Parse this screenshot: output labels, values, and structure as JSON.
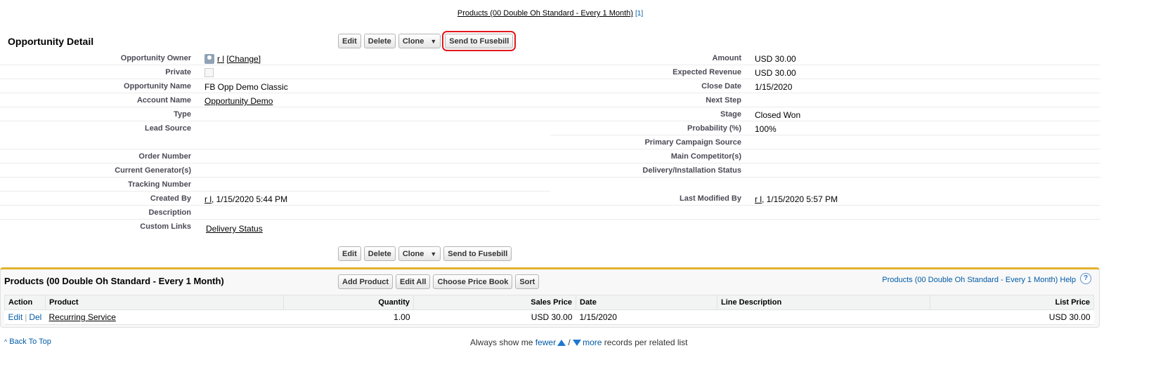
{
  "top_link": {
    "label": "Products (00 Double Oh Standard - Every 1 Month)",
    "count": "[1]"
  },
  "detail": {
    "title": "Opportunity Detail",
    "buttons": {
      "edit": "Edit",
      "delete": "Delete",
      "clone": "Clone",
      "send": "Send to Fusebill"
    },
    "left": {
      "owner_label": "Opportunity Owner",
      "owner_value": "r l",
      "owner_change": "[Change]",
      "private_label": "Private",
      "name_label": "Opportunity Name",
      "name_value": "FB Opp Demo Classic",
      "account_label": "Account Name",
      "account_value": "Opportunity Demo",
      "type_label": "Type",
      "lead_label": "Lead Source",
      "order_label": "Order Number",
      "generator_label": "Current Generator(s)",
      "tracking_label": "Tracking Number",
      "created_label": "Created By",
      "created_user": "r l",
      "created_date": ", 1/15/2020 5:44 PM",
      "description_label": "Description",
      "custom_label": "Custom Links",
      "custom_value": "Delivery Status"
    },
    "right": {
      "amount_label": "Amount",
      "amount_value": "USD 30.00",
      "expected_label": "Expected Revenue",
      "expected_value": "USD 30.00",
      "close_label": "Close Date",
      "close_value": "1/15/2020",
      "next_label": "Next Step",
      "stage_label": "Stage",
      "stage_value": "Closed Won",
      "prob_label": "Probability (%)",
      "prob_value": "100%",
      "campaign_label": "Primary Campaign Source",
      "competitor_label": "Main Competitor(s)",
      "delivery_label": "Delivery/Installation Status",
      "modified_label": "Last Modified By",
      "modified_user": "r l",
      "modified_date": ", 1/15/2020 5:57 PM"
    }
  },
  "products": {
    "title": "Products (00 Double Oh Standard - Every 1 Month)",
    "buttons": {
      "add": "Add Product",
      "edit_all": "Edit All",
      "price_book": "Choose Price Book",
      "sort": "Sort"
    },
    "help": "Products (00 Double Oh Standard - Every 1 Month) Help",
    "help_icon": "?",
    "columns": {
      "action": "Action",
      "product": "Product",
      "quantity": "Quantity",
      "sales_price": "Sales Price",
      "date": "Date",
      "line_desc": "Line Description",
      "list_price": "List Price"
    },
    "row": {
      "edit": "Edit",
      "sep": "|",
      "del": "Del",
      "product": "Recurring Service",
      "quantity": "1.00",
      "sales_price": "USD 30.00",
      "date": "1/15/2020",
      "line_desc": "",
      "list_price": "USD 30.00"
    }
  },
  "footer": {
    "back_to_top": "Back To Top",
    "always": "Always show me",
    "fewer": "fewer",
    "slash": "/",
    "more": "more",
    "suffix": "records per related list"
  }
}
